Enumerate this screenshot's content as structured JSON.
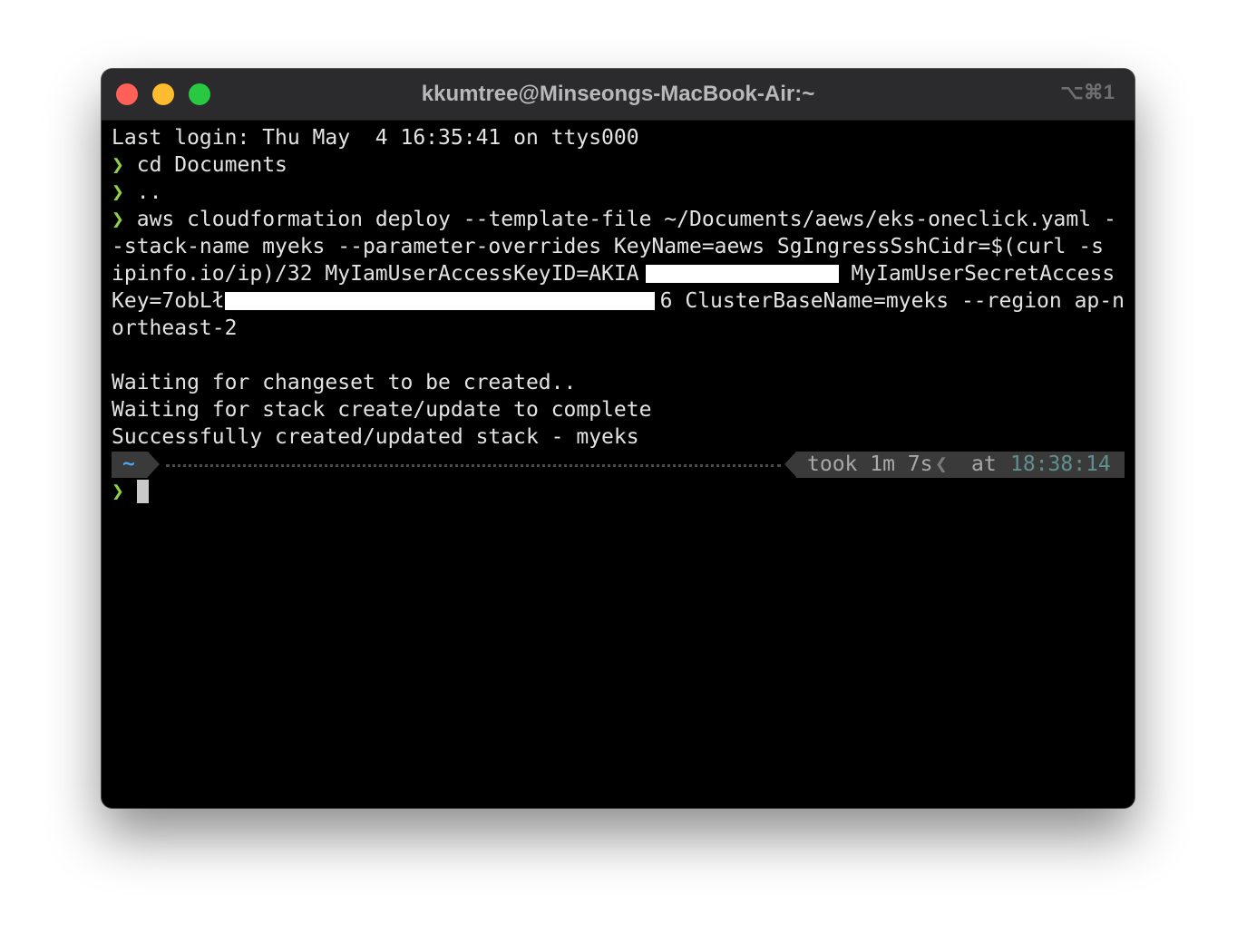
{
  "window": {
    "title": "kkumtree@Minseongs-MacBook-Air:~",
    "shortcut": "⌥⌘1"
  },
  "terminal": {
    "prompt_symbol": "❯",
    "last_login": "Last login: Thu May  4 16:35:41 on ttys000",
    "cmd1": "cd Documents",
    "cmd2": "..",
    "deploy": {
      "line1": "aws cloudformation deploy --template-file ~/Documents/aews/eks-oneclick.yaml -",
      "line2": "-stack-name myeks --parameter-overrides KeyName=aews SgIngressSshCidr=$(curl -s",
      "line3a": "ipinfo.io/ip)/32 MyIamUserAccessKeyID=AKIA",
      "line3b": " MyIamUserSecretAccess",
      "line4a": "Key=7obLł",
      "line4b": "6 ClusterBaseName=myeks --region ap-n",
      "line5": "ortheast-2"
    },
    "output": [
      "Waiting for changeset to be created..",
      "Waiting for stack create/update to complete",
      "Successfully created/updated stack - myeks"
    ],
    "status": {
      "dir": "~",
      "took": "took 1m 7s",
      "separator": "❮",
      "at": "at",
      "time": "18:38:14"
    }
  }
}
